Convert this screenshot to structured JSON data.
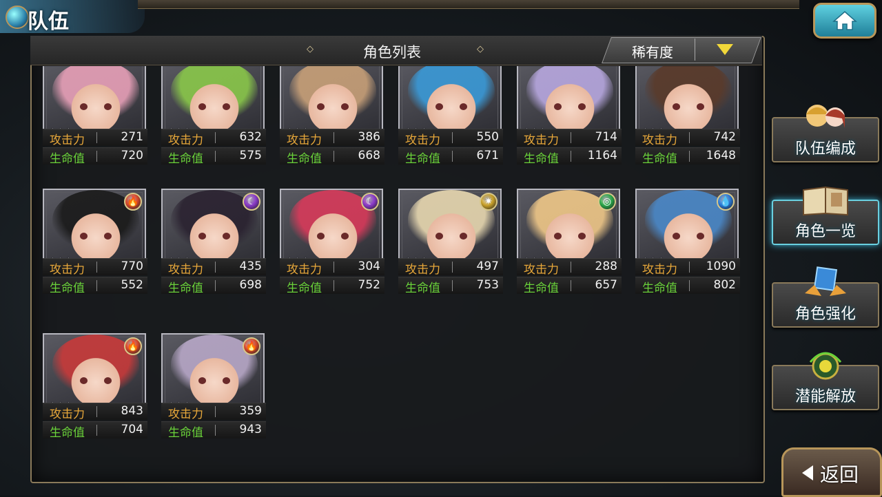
{
  "screen_title": "队伍",
  "header": {
    "title": "角色列表",
    "sort_label": "稀有度"
  },
  "side_menu": [
    {
      "label": "队伍编成",
      "active": false
    },
    {
      "label": "角色一览",
      "active": true
    },
    {
      "label": "角色强化",
      "active": false
    },
    {
      "label": "潜能解放",
      "active": false
    }
  ],
  "back_label": "返回",
  "stat_labels": {
    "atk": "攻击力",
    "hp": "生命值"
  },
  "stars_glyph": "★★★",
  "element_glyphs": {
    "fire": "🔥",
    "dark": "☾",
    "light": "✷",
    "wind": "◎",
    "water": "💧"
  },
  "element_colors": {
    "fire": "#d8482a",
    "dark": "#8a3ac8",
    "light": "#c8a02a",
    "wind": "#2aa84a",
    "water": "#2a7ad8"
  },
  "characters": [
    {
      "atk": "271",
      "hp": "720",
      "element": "",
      "hair": "#e8a0b8"
    },
    {
      "atk": "632",
      "hp": "575",
      "element": "",
      "hair": "#8ac84a"
    },
    {
      "atk": "386",
      "hp": "668",
      "element": "",
      "hair": "#c8a078"
    },
    {
      "atk": "550",
      "hp": "671",
      "element": "",
      "hair": "#3a9ad8"
    },
    {
      "atk": "714",
      "hp": "1164",
      "element": "",
      "hair": "#b8a8e0"
    },
    {
      "atk": "742",
      "hp": "1648",
      "element": "",
      "hair": "#5a3a2a"
    },
    {
      "atk": "770",
      "hp": "552",
      "element": "fire",
      "hair": "#1a1a1a"
    },
    {
      "atk": "435",
      "hp": "698",
      "element": "dark",
      "hair": "#2a2230"
    },
    {
      "atk": "304",
      "hp": "752",
      "element": "dark",
      "hair": "#d83a5a"
    },
    {
      "atk": "497",
      "hp": "753",
      "element": "light",
      "hair": "#e8d8b0"
    },
    {
      "atk": "288",
      "hp": "657",
      "element": "wind",
      "hair": "#f0c888"
    },
    {
      "atk": "1090",
      "hp": "802",
      "element": "water",
      "hair": "#4a88c8"
    },
    {
      "atk": "843",
      "hp": "704",
      "element": "fire",
      "hair": "#c83a3a"
    },
    {
      "atk": "359",
      "hp": "943",
      "element": "fire",
      "hair": "#b8a8c8"
    }
  ]
}
